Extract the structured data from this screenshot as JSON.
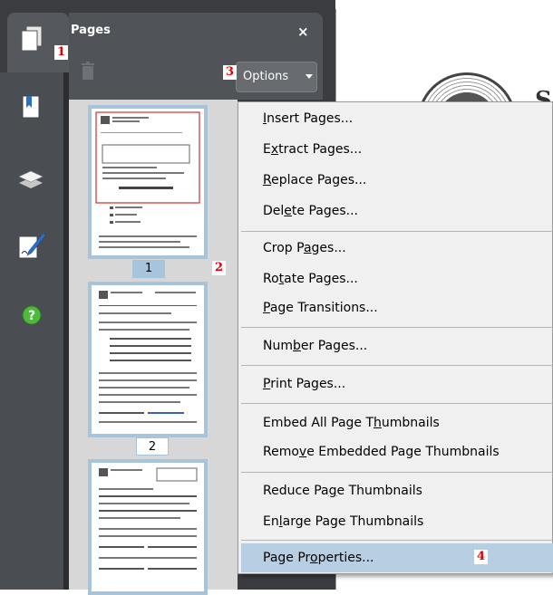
{
  "panel": {
    "title": "Pages",
    "close_label": "×"
  },
  "toolbar": {
    "options_label": "Options"
  },
  "thumbnails": [
    {
      "page_number": "1"
    },
    {
      "page_number": "2"
    }
  ],
  "document": {
    "visible_letter": "S"
  },
  "menu": {
    "items": [
      {
        "before": "",
        "mnemonic": "I",
        "after": "nsert Pages..."
      },
      {
        "before": "E",
        "mnemonic": "x",
        "after": "tract Pages..."
      },
      {
        "before": "",
        "mnemonic": "R",
        "after": "eplace Pages..."
      },
      {
        "before": "Del",
        "mnemonic": "e",
        "after": "te Pages..."
      },
      {
        "before": "Crop P",
        "mnemonic": "a",
        "after": "ges..."
      },
      {
        "before": "Ro",
        "mnemonic": "t",
        "after": "ate Pages..."
      },
      {
        "before": "",
        "mnemonic": "P",
        "after": "age Transitions..."
      },
      {
        "before": "Num",
        "mnemonic": "b",
        "after": "er Pages..."
      },
      {
        "before": "",
        "mnemonic": "P",
        "after": "rint Pages..."
      },
      {
        "before": "Embed All Page T",
        "mnemonic": "h",
        "after": "umbnails"
      },
      {
        "before": "Remo",
        "mnemonic": "v",
        "after": "e Embedded Page Thumbnails"
      },
      {
        "before": "Reduce Pa",
        "mnemonic": "g",
        "after": "e Thumbnails"
      },
      {
        "before": "En",
        "mnemonic": "l",
        "after": "arge Page Thumbnails"
      },
      {
        "before": "Page Pr",
        "mnemonic": "o",
        "after": "perties..."
      }
    ]
  },
  "callouts": [
    "1",
    "2",
    "3",
    "4"
  ],
  "colors": {
    "callout_red": "#e00000",
    "highlight": "#b8cfe3",
    "thumb_border": "#a6c5dd"
  },
  "icons": [
    "pages-icon",
    "trash-icon",
    "bookmarks-icon",
    "layers-icon",
    "signature-icon",
    "help-icon"
  ]
}
